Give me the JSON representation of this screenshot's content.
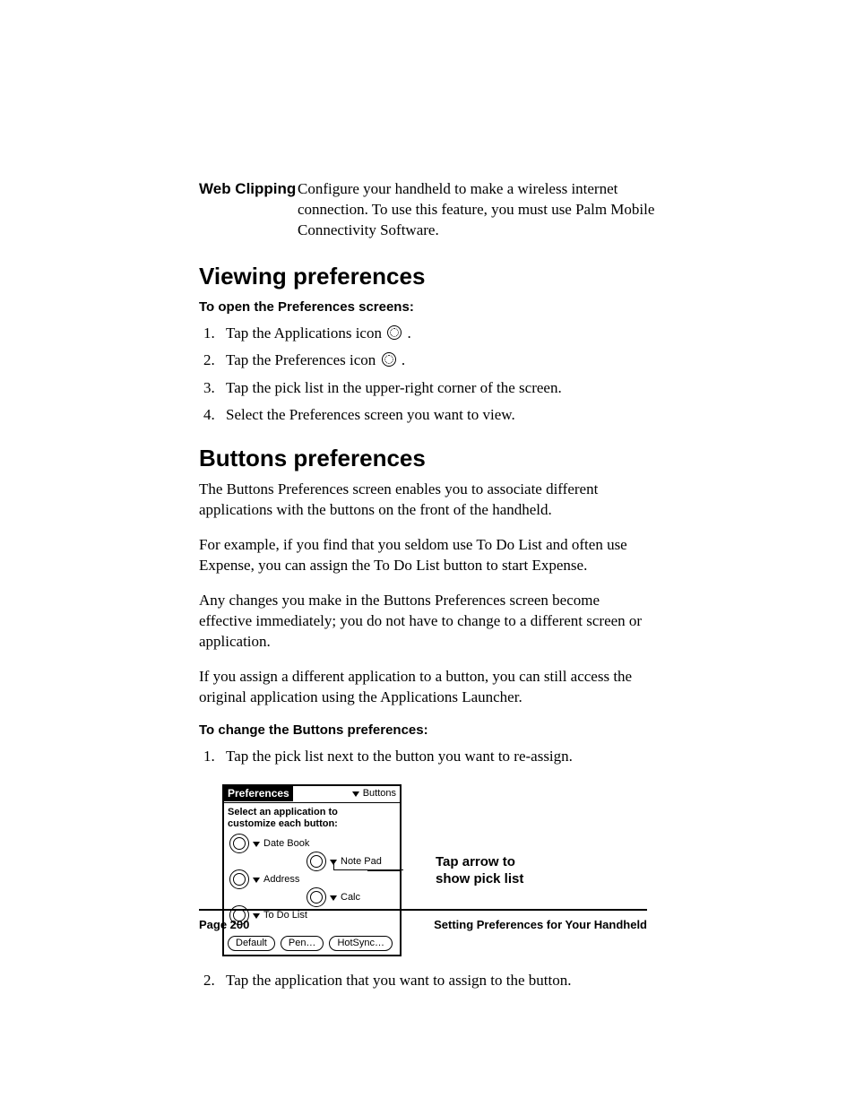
{
  "def": {
    "term": "Web Clipping",
    "desc": "Configure your handheld to make a wireless internet connection. To use this feature, you must use Palm Mobile Connectivity Software."
  },
  "sec1": {
    "title": "Viewing preferences",
    "subhead": "To open the Preferences screens:",
    "steps": {
      "s1a": "Tap the Applications icon ",
      "s1b": " .",
      "s2a": "Tap the Preferences icon ",
      "s2b": " .",
      "s3": "Tap the pick list in the upper-right corner of the screen.",
      "s4": "Select the Preferences screen you want to view."
    }
  },
  "sec2": {
    "title": "Buttons preferences",
    "p1": "The Buttons Preferences screen enables you to associate different applications with the buttons on the front of the handheld.",
    "p2": "For example, if you find that you seldom use To Do List and often use Expense, you can assign the To Do List button to start Expense.",
    "p3": "Any changes you make in the Buttons Preferences screen become effective immediately; you do not have to change to a different screen or application.",
    "p4": "If you assign a different application to a button, you can still access the original application using the Applications Launcher.",
    "subhead": "To change the Buttons preferences:",
    "step1": "Tap the pick list next to the button you want to re-assign.",
    "step2": "Tap the application that you want to assign to the button."
  },
  "palm": {
    "title": "Preferences",
    "picklist": "Buttons",
    "instr1": "Select an application to",
    "instr2": "customize each button:",
    "btn1": "Date Book",
    "btn2": "Note Pad",
    "btn3": "Address",
    "btn4": "Calc",
    "btn5": "To Do List",
    "f1": "Default",
    "f2": "Pen…",
    "f3": "HotSync…"
  },
  "callout": {
    "l1": "Tap arrow to",
    "l2": "show pick list"
  },
  "footer": {
    "page": "Page 200",
    "chapter": "Setting Preferences for Your Handheld"
  }
}
